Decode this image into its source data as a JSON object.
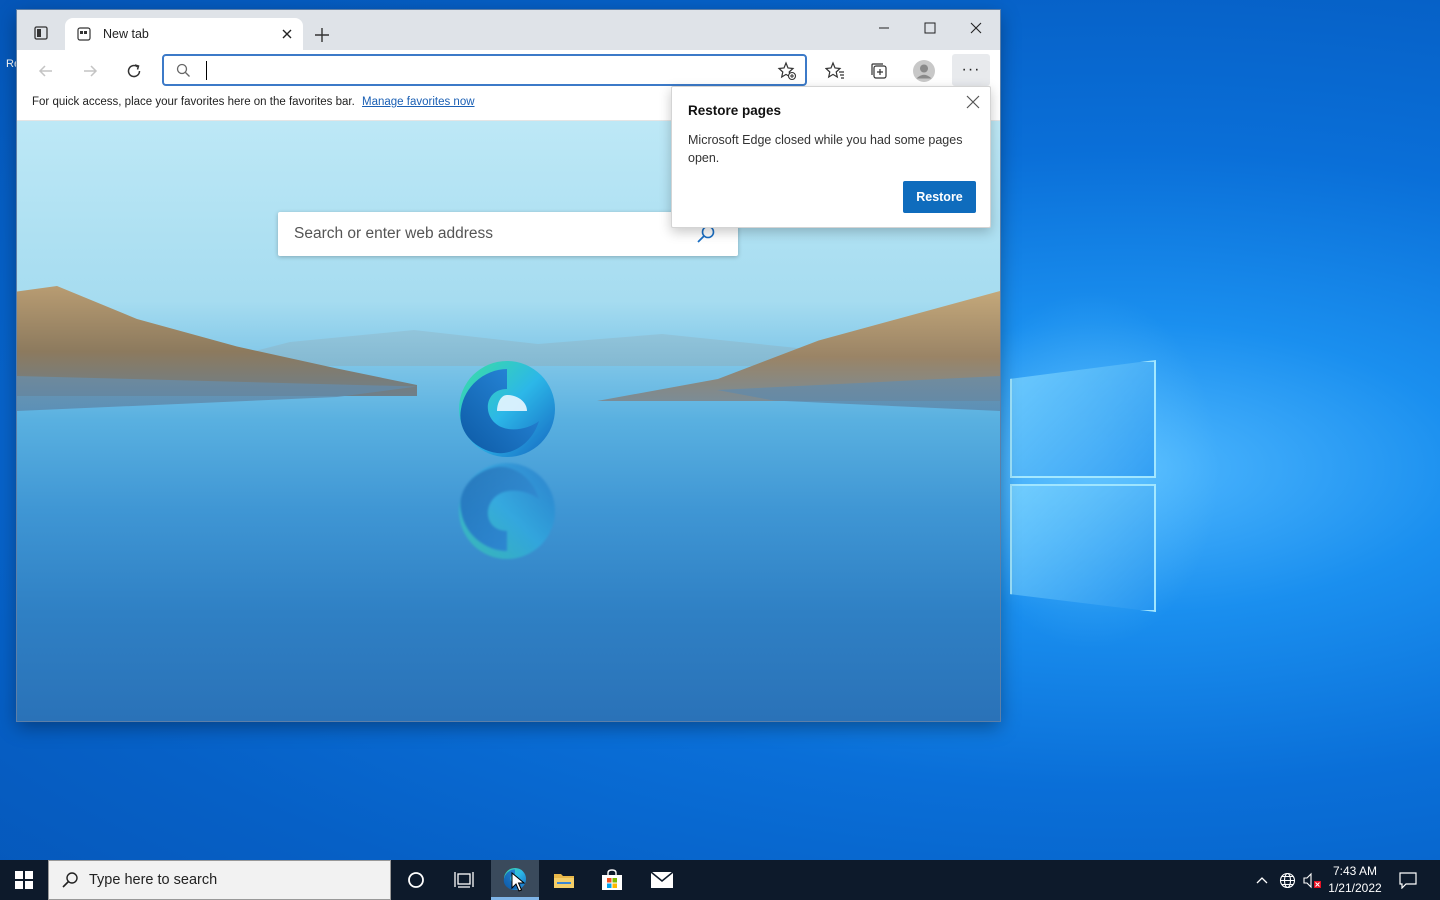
{
  "browser": {
    "tab": {
      "title": "New tab"
    },
    "address": {
      "value": "",
      "placeholder": ""
    },
    "favorites_bar": {
      "text": "For quick access, place your favorites here on the favorites bar.",
      "link": "Manage favorites now"
    },
    "newtab_search": {
      "placeholder": "Search or enter web address"
    }
  },
  "popup": {
    "title": "Restore pages",
    "body": "Microsoft Edge closed while you had some pages open.",
    "button": "Restore"
  },
  "taskbar": {
    "search_placeholder": "Type here to search",
    "time": "7:43 AM",
    "date": "1/21/2022"
  },
  "desktop": {
    "edge_text": "Re\n\nM"
  },
  "colors": {
    "accent": "#0f6cbd",
    "taskbar": "#0d1a2b",
    "desktop": "#0a6fd8"
  }
}
